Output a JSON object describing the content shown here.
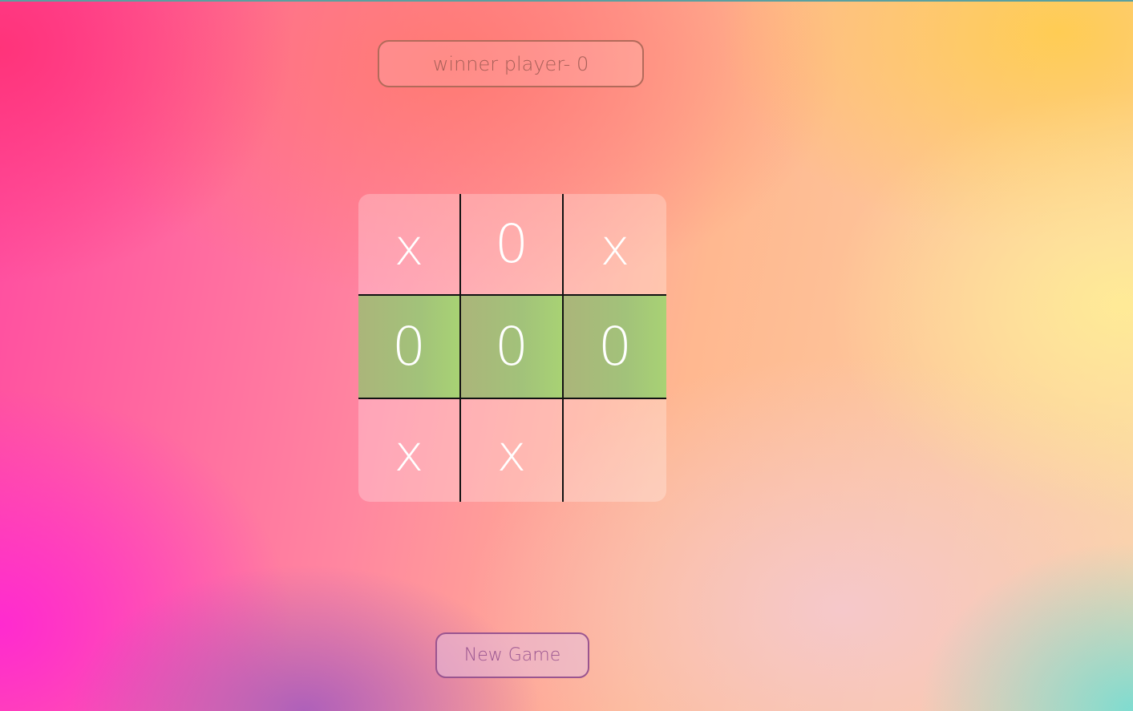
{
  "status": {
    "text": "winner player- 0"
  },
  "board": {
    "cells": [
      "x",
      "0",
      "x",
      "0",
      "0",
      "0",
      "x",
      "x",
      ""
    ],
    "winning_cells": [
      3,
      4,
      5
    ],
    "win_color": "#a8c97a"
  },
  "controls": {
    "new_game_label": "New Game"
  },
  "colors": {
    "mark": "#ffffff",
    "grid_line": "#111111",
    "status_text": "#a75f58",
    "button_text": "#9a5590"
  }
}
